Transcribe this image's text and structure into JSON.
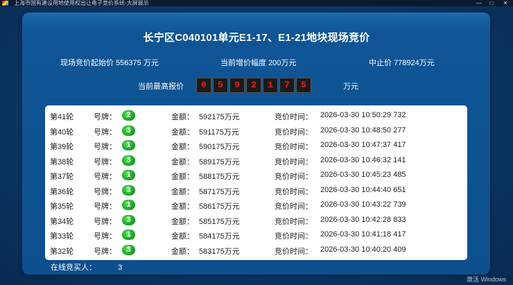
{
  "window": {
    "title": "上海市国有建设用地使用权出让电子竞价系统-大屏展示",
    "controls": [
      "—",
      "□",
      "✕"
    ]
  },
  "auction": {
    "title": "长宁区C040101单元E1-17、E1-21地块现场竞价",
    "start_price_label": "现场竞价起始价",
    "start_price_value": "556375",
    "start_price_unit": "万元",
    "increment_label": "当前增价幅度",
    "increment_value": "200万元",
    "stop_price_label": "中止价",
    "stop_price_value": "778924万元",
    "max_bid_label": "当前最高报价",
    "max_bid_digits": [
      "0",
      "5",
      "9",
      "2",
      "1",
      "7",
      "5"
    ],
    "max_bid_unit": "万元"
  },
  "labels": {
    "plate": "号牌：",
    "amount": "金额：",
    "time": "竞价时间："
  },
  "rounds": [
    {
      "round": "第41轮",
      "plate": "2",
      "amount": "592175万元",
      "time": "2026-03-30 10:50:29 732"
    },
    {
      "round": "第40轮",
      "plate": "3",
      "amount": "591175万元",
      "time": "2026-03-30 10:48:50 277"
    },
    {
      "round": "第39轮",
      "plate": "1",
      "amount": "590175万元",
      "time": "2026-03-30 10:47:37 417"
    },
    {
      "round": "第38轮",
      "plate": "3",
      "amount": "589175万元",
      "time": "2026-03-30 10:46:32 141"
    },
    {
      "round": "第37轮",
      "plate": "1",
      "amount": "588175万元",
      "time": "2026-03-30 10:45:23 485"
    },
    {
      "round": "第36轮",
      "plate": "3",
      "amount": "587175万元",
      "time": "2026-03-30 10:44:40 651"
    },
    {
      "round": "第35轮",
      "plate": "1",
      "amount": "586175万元",
      "time": "2026-03-30 10:43:22 739"
    },
    {
      "round": "第34轮",
      "plate": "3",
      "amount": "585175万元",
      "time": "2026-03-30 10:42:28 833"
    },
    {
      "round": "第33轮",
      "plate": "1",
      "amount": "584175万元",
      "time": "2026-03-30 10:41:18 417"
    },
    {
      "round": "第32轮",
      "plate": "3",
      "amount": "583175万元",
      "time": "2026-03-30 10:40:20 409"
    }
  ],
  "footer": {
    "online_label": "在线竞买人：",
    "online_count": "3"
  },
  "watermark": "激活 Windows",
  "colors": {
    "background": "#0b3a6b",
    "panel": "#0f5596",
    "digit_text": "#e02020",
    "badge": "#1faa2a"
  }
}
